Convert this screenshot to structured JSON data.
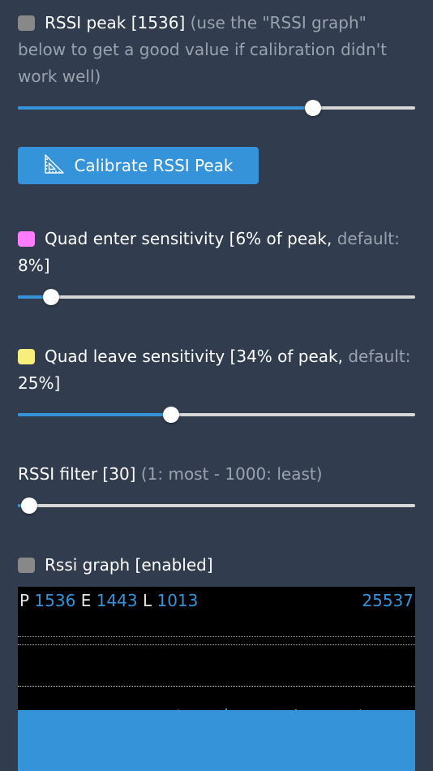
{
  "rssi_peak": {
    "label": "RSSI peak [1536]",
    "hint": "(use the \"RSSI graph\" below to get a good value if calibration didn't work well)",
    "swatch_color": "#888888",
    "slider_fraction": 0.742
  },
  "calibrate_button": {
    "label": "Calibrate RSSI Peak",
    "icon": "set-square-ruler-icon"
  },
  "quad_enter": {
    "label": "Quad enter sensitivity [6% of peak,",
    "hint": "default:",
    "tail": "8%]",
    "swatch_color": "#ff7cff",
    "slider_fraction": 0.083
  },
  "quad_leave": {
    "label": "Quad leave sensitivity [34% of peak,",
    "hint": "default:",
    "tail": "25%]",
    "swatch_color": "#f6ef7c",
    "slider_fraction": 0.385
  },
  "rssi_filter": {
    "label": "RSSI filter [30]",
    "hint": "(1: most - 1000: least)",
    "slider_fraction": 0.029
  },
  "rssi_graph": {
    "label": "Rssi graph [enabled]",
    "swatch_color": "#888888",
    "peak_prefix": "P",
    "peak_value": "1536",
    "enter_prefix": "E",
    "enter_value": "1443",
    "leave_prefix": "L",
    "leave_value": "1013",
    "counter": "25537",
    "colors": {
      "peak_line": "#aaaaaa",
      "enter_line": "#ff7cff",
      "leave_line": "#f6ef7c",
      "signal_area": "#3593da",
      "background": "#000000"
    },
    "signal_level": 1013
  }
}
